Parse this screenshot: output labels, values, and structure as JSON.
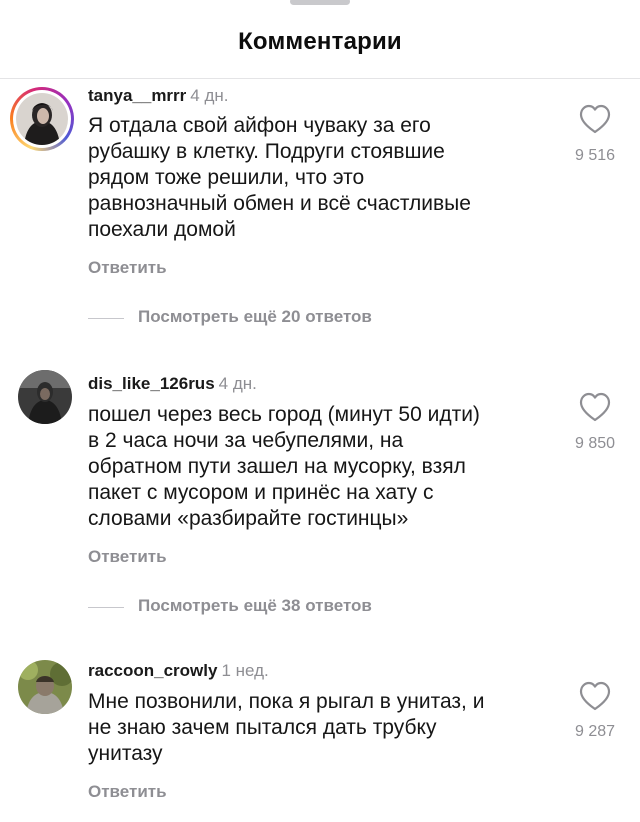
{
  "header": {
    "title": "Комментарии"
  },
  "comments": [
    {
      "username": "tanya__mrrr",
      "time": "4 дн.",
      "text": "Я отдала свой айфон чуваку за его\nрубашку в клетку. Подруги стоявшие\nрядом тоже решили, что это\nравнозначный обмен и всё счастливые\nпоехали домой",
      "reply_label": "Ответить",
      "likes": "9 516",
      "view_replies": "Посмотреть ещё 20 ответов",
      "has_story_ring": true
    },
    {
      "username": "dis_like_126rus",
      "time": "4 дн.",
      "text": "пошел через весь город (минут 50 идти)\nв 2 часа ночи за чебупелями, на\nобратном пути зашел на мусорку, взял\nпакет с мусором и принёс на хату с\nсловами «разбирайте гостинцы»",
      "reply_label": "Ответить",
      "likes": "9 850",
      "view_replies": "Посмотреть ещё 38 ответов",
      "has_story_ring": false
    },
    {
      "username": "raccoon_crowly",
      "time": "1 нед.",
      "text": "Мне позвонили, пока я рыгал в унитаз, и\nне знаю зачем пытался дать трубку\nунитазу",
      "reply_label": "Ответить",
      "likes": "9 287",
      "has_story_ring": false
    }
  ],
  "icons": {
    "like": "heart-outline-icon",
    "avatar": "avatar-image"
  },
  "colors": {
    "secondary_text": "#8e8e93",
    "divider": "#e4e4e6",
    "ring_gradient": [
      "#feda75",
      "#fa7e1e",
      "#d62976",
      "#962fbf",
      "#4f5bd5"
    ]
  }
}
